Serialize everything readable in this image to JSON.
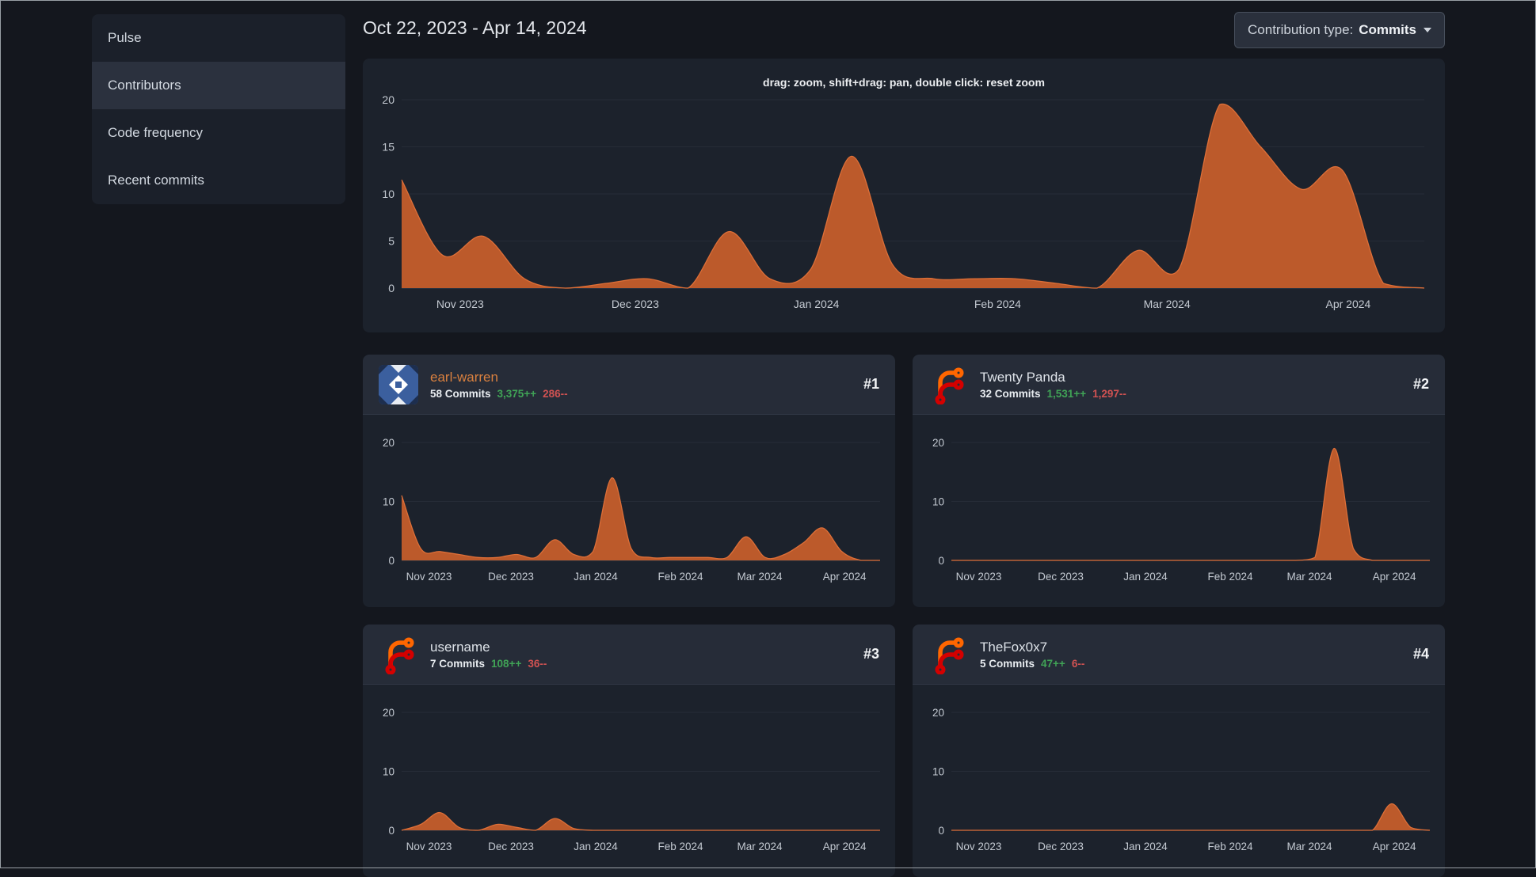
{
  "sidebar": {
    "items": [
      {
        "label": "Pulse",
        "active": false
      },
      {
        "label": "Contributors",
        "active": true
      },
      {
        "label": "Code frequency",
        "active": false
      },
      {
        "label": "Recent commits",
        "active": false
      }
    ]
  },
  "header": {
    "date_range": "Oct 22, 2023 - Apr 14, 2024",
    "contribution_type_label": "Contribution type:",
    "contribution_type_value": "Commits"
  },
  "main_chart": {
    "hint": "drag: zoom, shift+drag: pan, double click: reset zoom"
  },
  "contributors": [
    {
      "rank": "#1",
      "name": "earl-warren",
      "commits": "58 Commits",
      "additions": "3,375++",
      "deletions": "286--"
    },
    {
      "rank": "#2",
      "name": "Twenty Panda",
      "commits": "32 Commits",
      "additions": "1,531++",
      "deletions": "1,297--"
    },
    {
      "rank": "#3",
      "name": "username",
      "commits": "7 Commits",
      "additions": "108++",
      "deletions": "36--"
    },
    {
      "rank": "#4",
      "name": "TheFox0x7",
      "commits": "5 Commits",
      "additions": "47++",
      "deletions": "6--"
    }
  ],
  "colors": {
    "area_fill": "#bc5a2b",
    "area_stroke": "#dd6f38",
    "additions_green": "#40a356",
    "deletions_red": "#d05252",
    "accent_name_orange": "#d9803f",
    "forgejo_orange": "#ff6600",
    "forgejo_red": "#d40000"
  },
  "chart_data": {
    "type": "area",
    "unit": "commits per week",
    "x_start": "Oct 22, 2023",
    "x_end": "Apr 14, 2024",
    "weeks": 26,
    "month_ticks": [
      {
        "label": "Nov 2023",
        "week": 1.43
      },
      {
        "label": "Dec 2023",
        "week": 5.71
      },
      {
        "label": "Jan 2024",
        "week": 10.14
      },
      {
        "label": "Feb 2024",
        "week": 14.57
      },
      {
        "label": "Mar 2024",
        "week": 18.71
      },
      {
        "label": "Apr 2024",
        "week": 23.14
      }
    ],
    "main": {
      "ylim": [
        0,
        20
      ],
      "yticks": [
        0,
        5,
        10,
        15,
        20
      ],
      "values": [
        11.5,
        3.5,
        5.5,
        1,
        0,
        0.5,
        1,
        0,
        6,
        1,
        2,
        14,
        2.5,
        1,
        1,
        1,
        0.5,
        0,
        4,
        2,
        19.5,
        15,
        10.5,
        12.5,
        0.5,
        0
      ]
    },
    "minis": [
      {
        "name": "earl-warren",
        "ylim": [
          0,
          20
        ],
        "yticks": [
          0,
          10,
          20
        ],
        "values": [
          11,
          2,
          1.5,
          1,
          0.5,
          0.5,
          1,
          0.5,
          3.5,
          1,
          1.5,
          14,
          2,
          0.5,
          0.5,
          0.5,
          0.5,
          0.5,
          4,
          0.5,
          1,
          3,
          5.5,
          1.5,
          0,
          0
        ]
      },
      {
        "name": "Twenty Panda",
        "ylim": [
          0,
          20
        ],
        "yticks": [
          0,
          10,
          20
        ],
        "values": [
          0,
          0,
          0,
          0,
          0,
          0,
          0,
          0,
          0,
          0,
          0,
          0,
          0,
          0,
          0,
          0,
          0,
          0,
          0,
          0.5,
          19,
          2,
          0,
          0,
          0,
          0
        ]
      },
      {
        "name": "username",
        "ylim": [
          0,
          20
        ],
        "yticks": [
          0,
          10,
          20
        ],
        "values": [
          0,
          1,
          3,
          0.5,
          0,
          1,
          0.5,
          0,
          2,
          0.3,
          0,
          0,
          0,
          0,
          0,
          0,
          0,
          0,
          0,
          0,
          0,
          0,
          0,
          0,
          0,
          0
        ]
      },
      {
        "name": "TheFox0x7",
        "ylim": [
          0,
          20
        ],
        "yticks": [
          0,
          10,
          20
        ],
        "values": [
          0,
          0,
          0,
          0,
          0,
          0,
          0,
          0,
          0,
          0,
          0,
          0,
          0,
          0,
          0,
          0,
          0,
          0,
          0,
          0,
          0,
          0,
          0,
          4.5,
          0.5,
          0
        ]
      }
    ]
  }
}
